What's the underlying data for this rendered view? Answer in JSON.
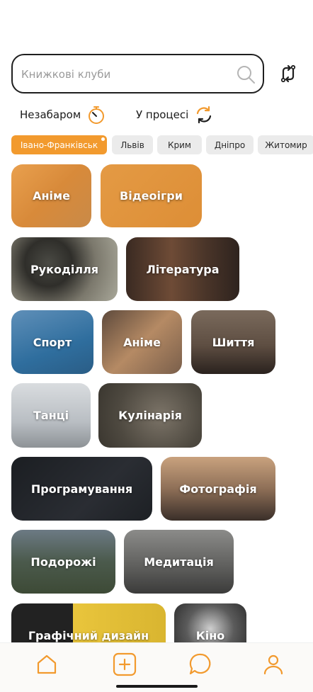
{
  "search": {
    "placeholder": "Книжкові клуби"
  },
  "filters": {
    "soon": "Незабаром",
    "in_progress": "У процесі"
  },
  "cities": [
    "Івано-Франківськ",
    "Львів",
    "Крим",
    "Дніпро",
    "Житомир"
  ],
  "categories": [
    "Аніме",
    "Відеоігри",
    "Рукоділля",
    "Література",
    "Спорт",
    "Аніме",
    "Шиття",
    "Танці",
    "Кулінарія",
    "Програмування",
    "Фотографія",
    "Подорожі",
    "Медитація",
    "Графічний дизайн",
    "Кіно"
  ],
  "colors": {
    "accent": "#f29a2e",
    "chip_bg": "#ebebeb",
    "text": "#1a1a1a"
  },
  "nav": [
    "home-icon",
    "add-icon",
    "chat-icon",
    "profile-icon"
  ]
}
